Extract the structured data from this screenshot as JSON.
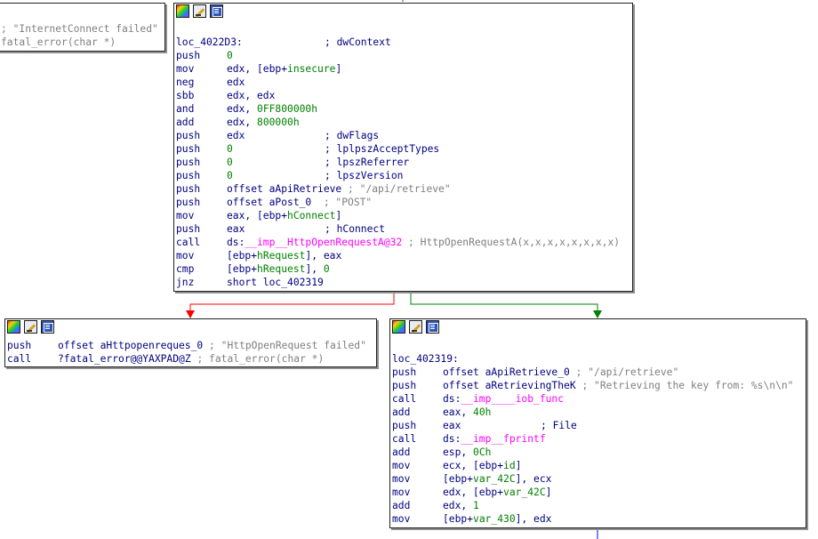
{
  "colors": {
    "mnemonic": "#000080",
    "immediate": "#008000",
    "import": "#ff00ff",
    "string_comment": "#7f7f7f",
    "edge_false": "#ff0000",
    "edge_true": "#008000",
    "edge_uncond": "#0000ff"
  },
  "header_icons": [
    "graph-color-icon",
    "edit-node-icon",
    "xrefs-icon"
  ],
  "partial_node": {
    "lines": [
      {
        "text": "; \"InternetConnect failed\"",
        "style": "str"
      },
      {
        "text": "fatal_error(char *)",
        "style": "str"
      }
    ]
  },
  "main_node": {
    "lines": [
      {
        "label": "loc_4022D3:",
        "comment": "; dwContext"
      },
      {
        "mnemonic": "push",
        "operands": [
          {
            "t": "0",
            "s": "num"
          }
        ]
      },
      {
        "mnemonic": "mov",
        "operands": [
          {
            "t": "edx, [ebp+",
            "s": ""
          },
          {
            "t": "insecure",
            "s": "var"
          },
          {
            "t": "]",
            "s": ""
          }
        ]
      },
      {
        "mnemonic": "neg",
        "operands": [
          {
            "t": "edx",
            "s": ""
          }
        ]
      },
      {
        "mnemonic": "sbb",
        "operands": [
          {
            "t": "edx, edx",
            "s": ""
          }
        ]
      },
      {
        "mnemonic": "and",
        "operands": [
          {
            "t": "edx, ",
            "s": ""
          },
          {
            "t": "0FF800000h",
            "s": "num"
          }
        ]
      },
      {
        "mnemonic": "add",
        "operands": [
          {
            "t": "edx, ",
            "s": ""
          },
          {
            "t": "800000h",
            "s": "num"
          }
        ]
      },
      {
        "mnemonic": "push",
        "operands": [
          {
            "t": "edx",
            "s": ""
          }
        ],
        "comment": "; dwFlags"
      },
      {
        "mnemonic": "push",
        "operands": [
          {
            "t": "0",
            "s": "num"
          }
        ],
        "comment": "; lplpszAcceptTypes"
      },
      {
        "mnemonic": "push",
        "operands": [
          {
            "t": "0",
            "s": "num"
          }
        ],
        "comment": "; lpszReferrer"
      },
      {
        "mnemonic": "push",
        "operands": [
          {
            "t": "0",
            "s": "num"
          }
        ],
        "comment": "; lpszVersion"
      },
      {
        "mnemonic": "push",
        "operands": [
          {
            "t": "offset aApiRetrieve",
            "s": ""
          },
          {
            "t": " ; \"/api/retrieve\"",
            "s": "str"
          }
        ]
      },
      {
        "mnemonic": "push",
        "operands": [
          {
            "t": "offset aPost_0",
            "s": ""
          },
          {
            "t": "  ; \"POST\"",
            "s": "str"
          }
        ]
      },
      {
        "mnemonic": "mov",
        "operands": [
          {
            "t": "eax, [ebp+",
            "s": ""
          },
          {
            "t": "hConnect",
            "s": "var"
          },
          {
            "t": "]",
            "s": ""
          }
        ]
      },
      {
        "mnemonic": "push",
        "operands": [
          {
            "t": "eax",
            "s": ""
          }
        ],
        "comment": "; hConnect"
      },
      {
        "mnemonic": "call",
        "operands": [
          {
            "t": "ds:",
            "s": ""
          },
          {
            "t": "__imp__HttpOpenRequestA@32",
            "s": "imp"
          },
          {
            "t": " ; HttpOpenRequestA(x,x,x,x,x,x,x,x)",
            "s": "str"
          }
        ]
      },
      {
        "mnemonic": "mov",
        "operands": [
          {
            "t": "[ebp+",
            "s": ""
          },
          {
            "t": "hRequest",
            "s": "var"
          },
          {
            "t": "], eax",
            "s": ""
          }
        ]
      },
      {
        "mnemonic": "cmp",
        "operands": [
          {
            "t": "[ebp+",
            "s": ""
          },
          {
            "t": "hRequest",
            "s": "var"
          },
          {
            "t": "], ",
            "s": ""
          },
          {
            "t": "0",
            "s": "num"
          }
        ]
      },
      {
        "mnemonic": "jnz",
        "operands": [
          {
            "t": "short loc_402319",
            "s": ""
          }
        ]
      }
    ]
  },
  "fail_node": {
    "lines": [
      {
        "mnemonic": "push",
        "operands": [
          {
            "t": "offset aHttpopenreques_0",
            "s": ""
          },
          {
            "t": " ; \"HttpOpenRequest failed\"",
            "s": "str"
          }
        ]
      },
      {
        "mnemonic": "call",
        "operands": [
          {
            "t": "?fatal_error@@YAXPAD@Z",
            "s": ""
          },
          {
            "t": " ; fatal_error(char *)",
            "s": "str"
          }
        ]
      }
    ]
  },
  "success_node": {
    "lines": [
      {
        "blank": true
      },
      {
        "label": "loc_402319:"
      },
      {
        "mnemonic": "push",
        "operands": [
          {
            "t": "offset aApiRetrieve_0",
            "s": ""
          },
          {
            "t": " ; \"/api/retrieve\"",
            "s": "str"
          }
        ]
      },
      {
        "mnemonic": "push",
        "operands": [
          {
            "t": "offset aRetrievingTheK",
            "s": ""
          },
          {
            "t": " ; \"Retrieving the key from: %s\\n\\n\"",
            "s": "str"
          }
        ]
      },
      {
        "mnemonic": "call",
        "operands": [
          {
            "t": "ds:",
            "s": ""
          },
          {
            "t": "__imp____iob_func",
            "s": "imp"
          }
        ]
      },
      {
        "mnemonic": "add",
        "operands": [
          {
            "t": "eax, ",
            "s": ""
          },
          {
            "t": "40h",
            "s": "num"
          }
        ]
      },
      {
        "mnemonic": "push",
        "operands": [
          {
            "t": "eax",
            "s": ""
          }
        ],
        "comment": "; File"
      },
      {
        "mnemonic": "call",
        "operands": [
          {
            "t": "ds:",
            "s": ""
          },
          {
            "t": "__imp__fprintf",
            "s": "imp"
          }
        ]
      },
      {
        "mnemonic": "add",
        "operands": [
          {
            "t": "esp, ",
            "s": ""
          },
          {
            "t": "0Ch",
            "s": "num"
          }
        ]
      },
      {
        "mnemonic": "mov",
        "operands": [
          {
            "t": "ecx, [ebp+",
            "s": ""
          },
          {
            "t": "id",
            "s": "var"
          },
          {
            "t": "]",
            "s": ""
          }
        ]
      },
      {
        "mnemonic": "mov",
        "operands": [
          {
            "t": "[ebp+",
            "s": ""
          },
          {
            "t": "var_42C",
            "s": "var"
          },
          {
            "t": "], ecx",
            "s": ""
          }
        ]
      },
      {
        "mnemonic": "mov",
        "operands": [
          {
            "t": "edx, [ebp+",
            "s": ""
          },
          {
            "t": "var_42C",
            "s": "var"
          },
          {
            "t": "]",
            "s": ""
          }
        ]
      },
      {
        "mnemonic": "add",
        "operands": [
          {
            "t": "edx, ",
            "s": ""
          },
          {
            "t": "1",
            "s": "num"
          }
        ]
      },
      {
        "mnemonic": "mov",
        "operands": [
          {
            "t": "[ebp+",
            "s": ""
          },
          {
            "t": "var_430",
            "s": "var"
          },
          {
            "t": "], edx",
            "s": ""
          }
        ]
      }
    ]
  }
}
